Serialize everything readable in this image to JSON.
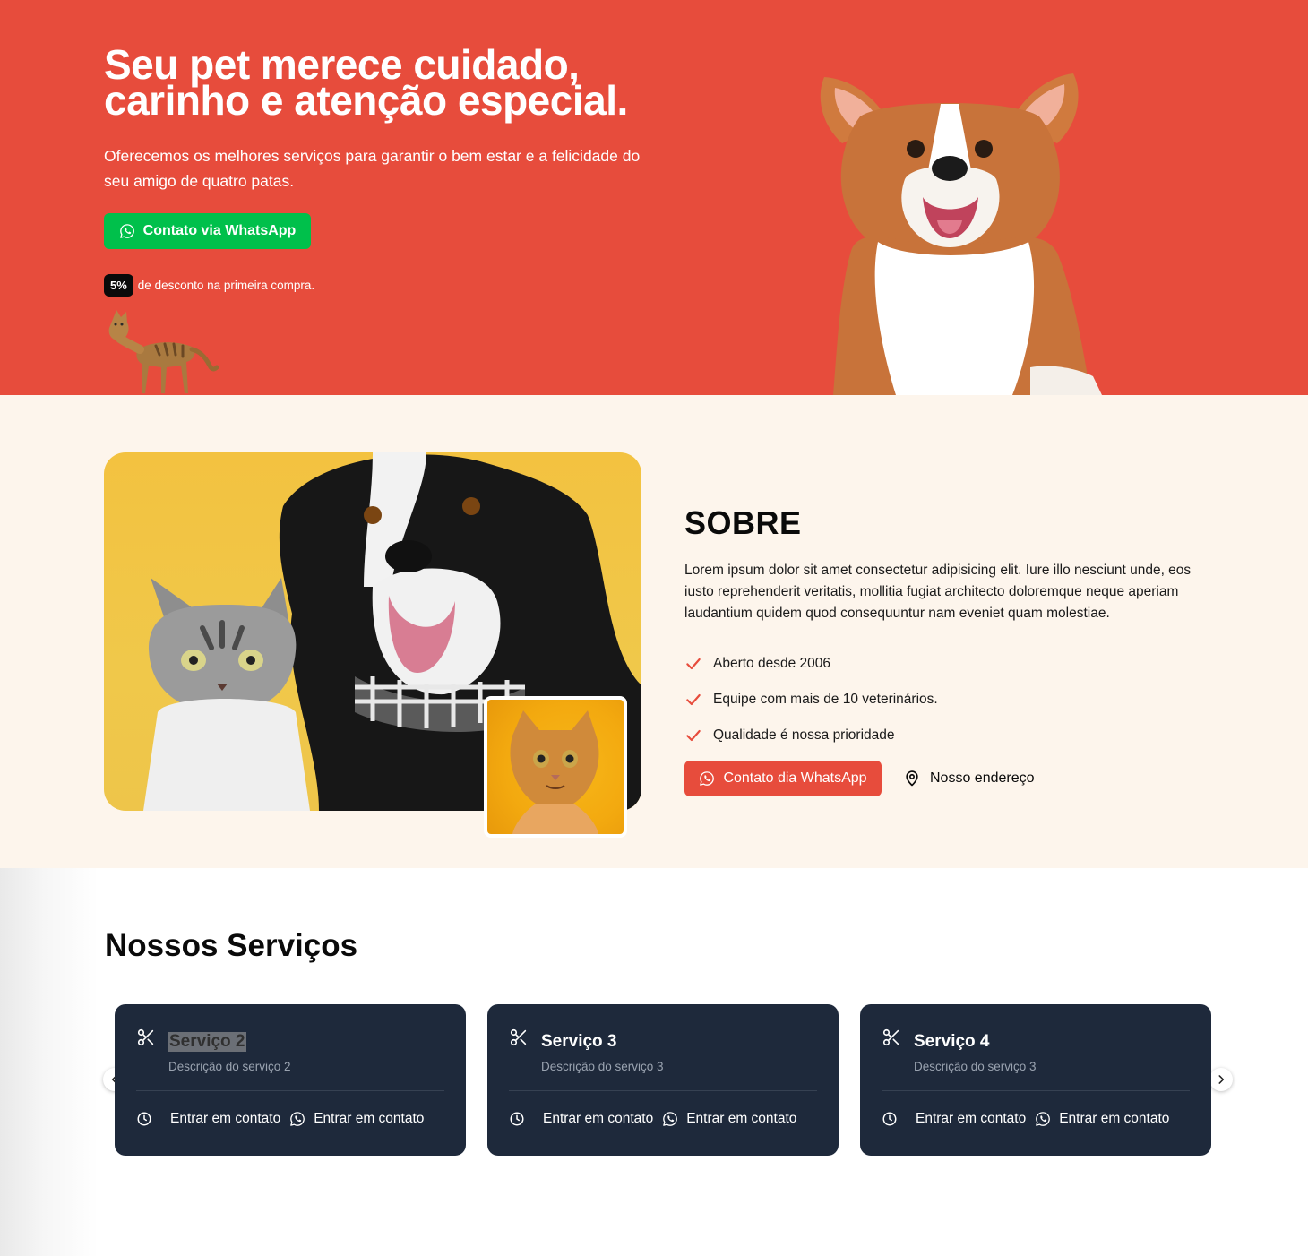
{
  "hero": {
    "title_line1": "Seu pet merece cuidado,",
    "title_line2": "carinho e atenção especial.",
    "subtitle": "Oferecemos os melhores serviços para garantir o bem estar e a felicidade do seu amigo de quatro patas.",
    "whatsapp_button": "Contato via WhatsApp",
    "discount_badge": "5%",
    "discount_text": "de desconto na primeira compra.",
    "background_color": "#e74c3c"
  },
  "about": {
    "title": "SOBRE",
    "text": "Lorem ipsum dolor sit amet consectetur adipisicing elit. Iure illo nesciunt unde, eos iusto reprehenderit veritatis, mollitia fugiat architecto doloremque neque aperiam laudantium quidem quod consequuntur nam eveniet quam molestiae.",
    "features": [
      "Aberto desde 2006",
      "Equipe com mais de 10 veterinários.",
      "Qualidade é nossa prioridade"
    ],
    "whatsapp_button": "Contato dia WhatsApp",
    "address_button": "Nosso endereço",
    "background_color": "#fdf5ec"
  },
  "services": {
    "title": "Nossos Serviços",
    "cards": [
      {
        "title": "Serviço 2",
        "description": "Descrição do serviço 2",
        "contact_label": "Entrar em contato",
        "whatsapp_label": "Entrar em contato",
        "icon": "scissors-icon"
      },
      {
        "title": "Serviço 3",
        "description": "Descrição do serviço 3",
        "contact_label": "Entrar em contato",
        "whatsapp_label": "Entrar em contato",
        "icon": "scissors-icon"
      },
      {
        "title": "Serviço 4",
        "description": "Descrição do serviço 3",
        "contact_label": "Entrar em contato",
        "whatsapp_label": "Entrar em contato",
        "icon": "scissors-icon"
      }
    ],
    "card_color": "#1e293b"
  },
  "colors": {
    "accent_red": "#e74c3c",
    "whatsapp_green": "#00c04b",
    "dark_navy": "#1e293b"
  }
}
